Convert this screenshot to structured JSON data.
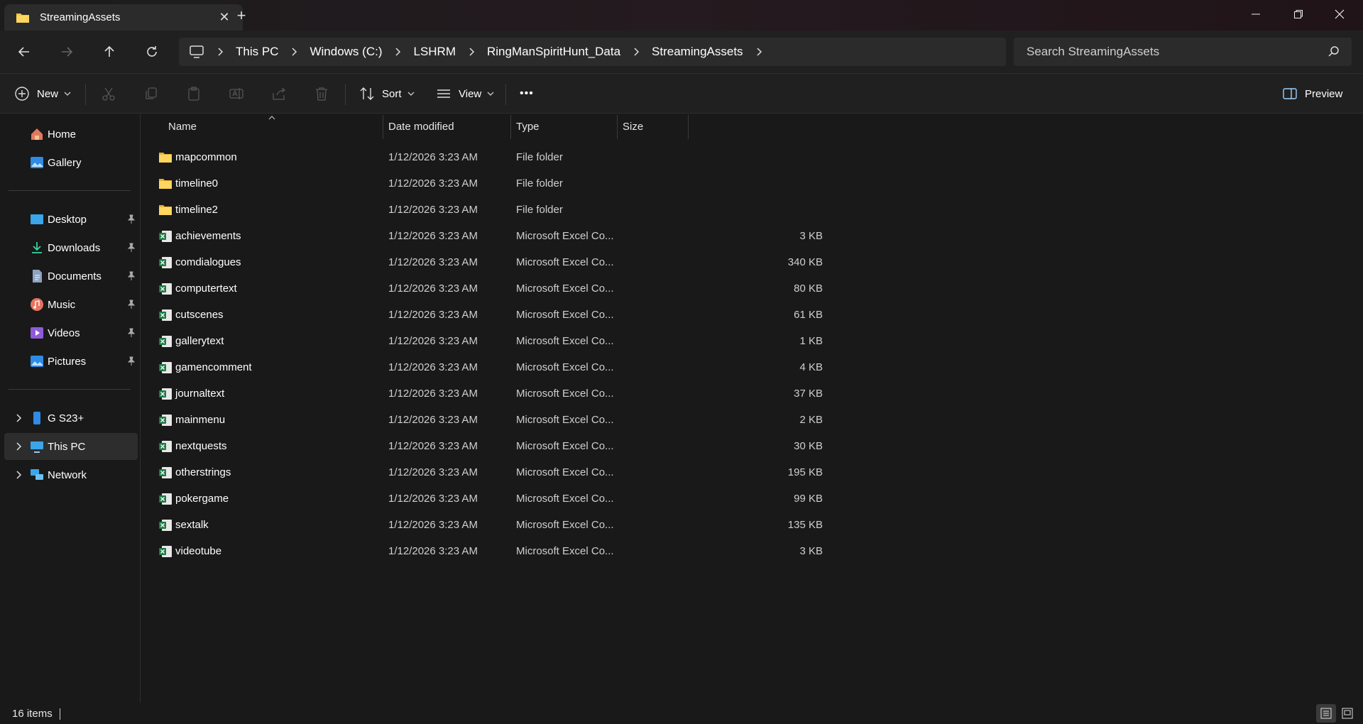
{
  "window": {
    "tab_title": "StreamingAssets",
    "new_tab": "+",
    "close_tab": "✕"
  },
  "address": {
    "crumbs": [
      "This PC",
      "Windows (C:)",
      "LSHRM",
      "RingManSpiritHunt_Data",
      "StreamingAssets"
    ]
  },
  "search": {
    "placeholder": "Search StreamingAssets"
  },
  "toolbar": {
    "new_label": "New",
    "sort_label": "Sort",
    "view_label": "View",
    "more_label": "•••",
    "preview_label": "Preview"
  },
  "sidebar": {
    "home": "Home",
    "gallery": "Gallery",
    "desktop": "Desktop",
    "downloads": "Downloads",
    "documents": "Documents",
    "music": "Music",
    "videos": "Videos",
    "pictures": "Pictures",
    "phone": "G S23+",
    "thispc": "This PC",
    "network": "Network"
  },
  "columns": {
    "name": "Name",
    "date": "Date modified",
    "type": "Type",
    "size": "Size"
  },
  "files": [
    {
      "name": "mapcommon",
      "date": "1/12/2026 3:23 AM",
      "type": "File folder",
      "size": "",
      "kind": "folder"
    },
    {
      "name": "timeline0",
      "date": "1/12/2026 3:23 AM",
      "type": "File folder",
      "size": "",
      "kind": "folder"
    },
    {
      "name": "timeline2",
      "date": "1/12/2026 3:23 AM",
      "type": "File folder",
      "size": "",
      "kind": "folder"
    },
    {
      "name": "achievements",
      "date": "1/12/2026 3:23 AM",
      "type": "Microsoft Excel Co...",
      "size": "3 KB",
      "kind": "excel"
    },
    {
      "name": "comdialogues",
      "date": "1/12/2026 3:23 AM",
      "type": "Microsoft Excel Co...",
      "size": "340 KB",
      "kind": "excel"
    },
    {
      "name": "computertext",
      "date": "1/12/2026 3:23 AM",
      "type": "Microsoft Excel Co...",
      "size": "80 KB",
      "kind": "excel"
    },
    {
      "name": "cutscenes",
      "date": "1/12/2026 3:23 AM",
      "type": "Microsoft Excel Co...",
      "size": "61 KB",
      "kind": "excel"
    },
    {
      "name": "gallerytext",
      "date": "1/12/2026 3:23 AM",
      "type": "Microsoft Excel Co...",
      "size": "1 KB",
      "kind": "excel"
    },
    {
      "name": "gamencomment",
      "date": "1/12/2026 3:23 AM",
      "type": "Microsoft Excel Co...",
      "size": "4 KB",
      "kind": "excel"
    },
    {
      "name": "journaltext",
      "date": "1/12/2026 3:23 AM",
      "type": "Microsoft Excel Co...",
      "size": "37 KB",
      "kind": "excel"
    },
    {
      "name": "mainmenu",
      "date": "1/12/2026 3:23 AM",
      "type": "Microsoft Excel Co...",
      "size": "2 KB",
      "kind": "excel"
    },
    {
      "name": "nextquests",
      "date": "1/12/2026 3:23 AM",
      "type": "Microsoft Excel Co...",
      "size": "30 KB",
      "kind": "excel"
    },
    {
      "name": "otherstrings",
      "date": "1/12/2026 3:23 AM",
      "type": "Microsoft Excel Co...",
      "size": "195 KB",
      "kind": "excel"
    },
    {
      "name": "pokergame",
      "date": "1/12/2026 3:23 AM",
      "type": "Microsoft Excel Co...",
      "size": "99 KB",
      "kind": "excel"
    },
    {
      "name": "sextalk",
      "date": "1/12/2026 3:23 AM",
      "type": "Microsoft Excel Co...",
      "size": "135 KB",
      "kind": "excel"
    },
    {
      "name": "videotube",
      "date": "1/12/2026 3:23 AM",
      "type": "Microsoft Excel Co...",
      "size": "3 KB",
      "kind": "excel"
    }
  ],
  "status": {
    "item_count": "16 items"
  },
  "colors": {
    "background": "#191919",
    "chrome": "#202020",
    "folder": "#f5c542",
    "excel": "#1f7a45"
  }
}
